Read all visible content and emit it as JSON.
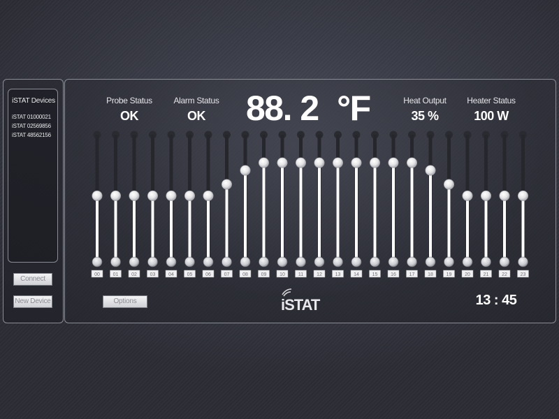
{
  "devices": {
    "header": "iSTAT Devices",
    "items": [
      "iSTAT 01000021",
      "iSTAT 02569856",
      "iSTAT 48562156"
    ]
  },
  "buttons": {
    "connect": "Connect",
    "new_device": "New Device",
    "options": "Options"
  },
  "status": {
    "probe_label": "Probe Status",
    "probe_value": "OK",
    "alarm_label": "Alarm Status",
    "alarm_value": "OK",
    "heat_label": "Heat Output",
    "heat_value": "35 %",
    "heater_label": "Heater Status",
    "heater_value": "100 W"
  },
  "temperature": {
    "value": "88. 2",
    "unit": "°F"
  },
  "clock": "13 : 45",
  "logo_text": "iSTAT",
  "schedule": {
    "hours": [
      "00",
      "01",
      "02",
      "03",
      "04",
      "05",
      "06",
      "07",
      "08",
      "09",
      "10",
      "11",
      "12",
      "13",
      "14",
      "15",
      "16",
      "17",
      "18",
      "19",
      "20",
      "21",
      "22",
      "23"
    ],
    "levels": [
      0.52,
      0.52,
      0.52,
      0.52,
      0.52,
      0.52,
      0.52,
      0.61,
      0.72,
      0.78,
      0.78,
      0.78,
      0.78,
      0.78,
      0.78,
      0.78,
      0.78,
      0.78,
      0.72,
      0.61,
      0.52,
      0.52,
      0.52,
      0.52
    ]
  },
  "colors": {
    "panel_border": "#8a8c96",
    "knob": "#f2f2f2",
    "track_fill": "#ffffff"
  }
}
